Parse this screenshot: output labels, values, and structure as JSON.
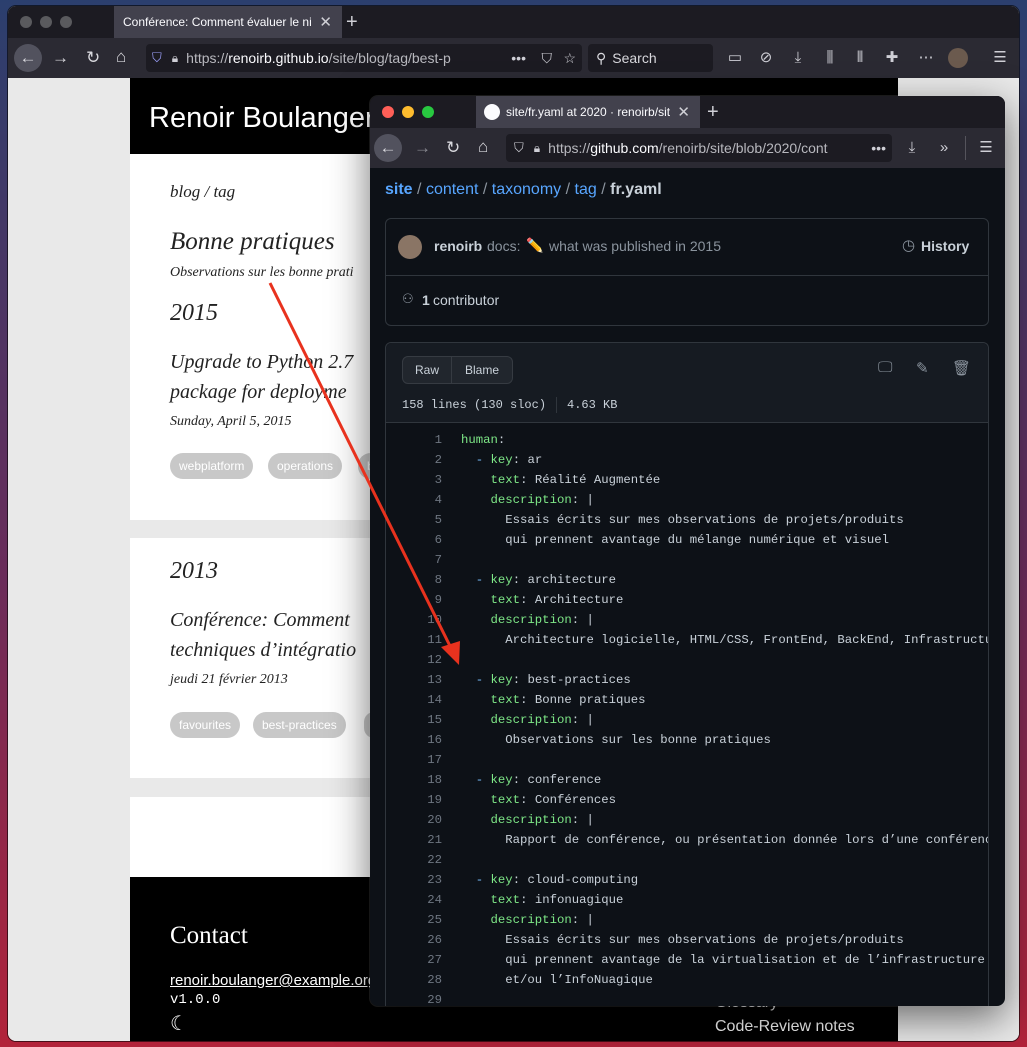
{
  "back_browser": {
    "tab_title": "Conférence: Comment évaluer le ni",
    "url_domain": "renoirb.github.io",
    "url_path": "/site/blog/tag/best-p",
    "url_scheme": "https://",
    "search_placeholder": "Search"
  },
  "blog": {
    "brand": "Renoir Boulanger",
    "breadcrumb": "blog / tag",
    "tag_title": "Bonne pratiques",
    "tag_description": "Observations sur les bonne prati",
    "section_2015": {
      "year": "2015",
      "post_title_line1": "Upgrade to Python 2.7",
      "post_title_line2": "package for deployme",
      "post_date": "Sunday, April 5, 2015",
      "tags": [
        "webplatform",
        "operations",
        "b"
      ]
    },
    "section_2013": {
      "year": "2013",
      "post_title_line1": "Conférence: Comment",
      "post_title_line2": "techniques d’intégratio",
      "post_date": "jeudi 21 février 2013",
      "tags": [
        "favourites",
        "best-practices",
        ""
      ]
    },
    "footer": {
      "contact_heading": "Contact",
      "email": "renoir.boulanger@example.org",
      "version": "v1.0.0",
      "link_glossary": "Glossary",
      "link_code_review": "Code-Review notes"
    }
  },
  "front_browser": {
    "tab_title": "site/fr.yaml at 2020 · renoirb/sit",
    "url_scheme": "https://",
    "url_domain": "github.com",
    "url_path": "/renoirb/site/blob/2020/cont"
  },
  "github": {
    "breadcrumb": {
      "repo": "site",
      "sep": "/",
      "path": [
        "content",
        "taxonomy",
        "tag"
      ],
      "file": "fr.yaml"
    },
    "commit": {
      "author": "renoirb",
      "message_prefix": "docs:",
      "emoji": "✏️",
      "message": "what was published in 2015",
      "history_label": "History"
    },
    "contributors": {
      "count": "1",
      "label": "contributor"
    },
    "file_toolbar": {
      "raw_label": "Raw",
      "blame_label": "Blame",
      "lines_info": "158 lines (130 sloc)",
      "size": "4.63 KB"
    },
    "code_lines": [
      {
        "n": "1",
        "indent": "",
        "dash": "",
        "key": "human",
        "value": ""
      },
      {
        "n": "2",
        "indent": "  ",
        "dash": "-",
        "key": "key",
        "value": "ar"
      },
      {
        "n": "3",
        "indent": "    ",
        "dash": "",
        "key": "text",
        "value": "Réalité Augmentée"
      },
      {
        "n": "4",
        "indent": "    ",
        "dash": "",
        "key": "description",
        "value": "|"
      },
      {
        "n": "5",
        "indent": "      ",
        "dash": "",
        "key": "",
        "value": "Essais écrits sur mes observations de projets/produits"
      },
      {
        "n": "6",
        "indent": "      ",
        "dash": "",
        "key": "",
        "value": "qui prennent avantage du mélange numérique et visuel"
      },
      {
        "n": "7",
        "indent": "",
        "dash": "",
        "key": "",
        "value": ""
      },
      {
        "n": "8",
        "indent": "  ",
        "dash": "-",
        "key": "key",
        "value": "architecture"
      },
      {
        "n": "9",
        "indent": "    ",
        "dash": "",
        "key": "text",
        "value": "Architecture"
      },
      {
        "n": "10",
        "indent": "    ",
        "dash": "",
        "key": "description",
        "value": "|"
      },
      {
        "n": "11",
        "indent": "      ",
        "dash": "",
        "key": "",
        "value": "Architecture logicielle, HTML/CSS, FrontEnd, BackEnd, Infrastructure."
      },
      {
        "n": "12",
        "indent": "",
        "dash": "",
        "key": "",
        "value": ""
      },
      {
        "n": "13",
        "indent": "  ",
        "dash": "-",
        "key": "key",
        "value": "best-practices"
      },
      {
        "n": "14",
        "indent": "    ",
        "dash": "",
        "key": "text",
        "value": "Bonne pratiques"
      },
      {
        "n": "15",
        "indent": "    ",
        "dash": "",
        "key": "description",
        "value": "|"
      },
      {
        "n": "16",
        "indent": "      ",
        "dash": "",
        "key": "",
        "value": "Observations sur les bonne pratiques"
      },
      {
        "n": "17",
        "indent": "",
        "dash": "",
        "key": "",
        "value": ""
      },
      {
        "n": "18",
        "indent": "  ",
        "dash": "-",
        "key": "key",
        "value": "conference"
      },
      {
        "n": "19",
        "indent": "    ",
        "dash": "",
        "key": "text",
        "value": "Conférences"
      },
      {
        "n": "20",
        "indent": "    ",
        "dash": "",
        "key": "description",
        "value": "|"
      },
      {
        "n": "21",
        "indent": "      ",
        "dash": "",
        "key": "",
        "value": "Rapport de conférence, ou présentation donnée lors d’une conférence"
      },
      {
        "n": "22",
        "indent": "",
        "dash": "",
        "key": "",
        "value": ""
      },
      {
        "n": "23",
        "indent": "  ",
        "dash": "-",
        "key": "key",
        "value": "cloud-computing"
      },
      {
        "n": "24",
        "indent": "    ",
        "dash": "",
        "key": "text",
        "value": "infonuagique"
      },
      {
        "n": "25",
        "indent": "    ",
        "dash": "",
        "key": "description",
        "value": "|"
      },
      {
        "n": "26",
        "indent": "      ",
        "dash": "",
        "key": "",
        "value": "Essais écrits sur mes observations de projets/produits"
      },
      {
        "n": "27",
        "indent": "      ",
        "dash": "",
        "key": "",
        "value": "qui prennent avantage de la virtualisation et de l’infrastructure"
      },
      {
        "n": "28",
        "indent": "      ",
        "dash": "",
        "key": "",
        "value": "et/ou l’InfoNuagique"
      },
      {
        "n": "29",
        "indent": "",
        "dash": "",
        "key": "",
        "value": ""
      }
    ]
  },
  "colors": {
    "annotation_arrow": "#e8321e",
    "yaml_key": "#7ee787",
    "link": "#58a6ff"
  }
}
